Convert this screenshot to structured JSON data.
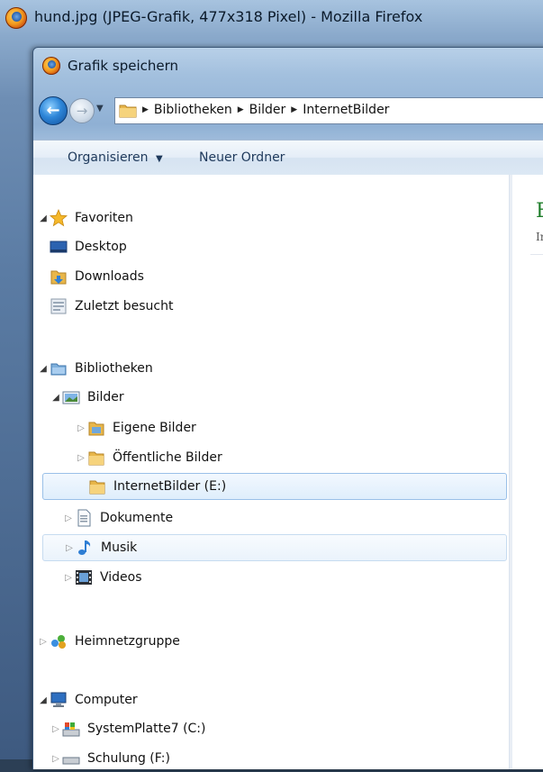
{
  "firefox": {
    "window_title": "hund.jpg (JPEG-Grafik, 477x318 Pixel) - Mozilla Firefox"
  },
  "dialog": {
    "title": "Grafik speichern",
    "breadcrumbs": [
      "Bibliotheken",
      "Bilder",
      "InternetBilder"
    ],
    "toolbar": {
      "organize": "Organisieren",
      "new_folder": "Neuer Ordner"
    },
    "nav_tree": {
      "favorites": {
        "label": "Favoriten",
        "items": [
          "Desktop",
          "Downloads",
          "Zuletzt besucht"
        ]
      },
      "libraries": {
        "label": "Bibliotheken",
        "pictures": {
          "label": "Bilder",
          "items": [
            "Eigene Bilder",
            "Öffentliche Bilder",
            "InternetBilder (E:)"
          ]
        },
        "items": [
          "Dokumente",
          "Musik",
          "Videos"
        ]
      },
      "homegroup": "Heimnetzgruppe",
      "computer": {
        "label": "Computer",
        "items": [
          "SystemPlatte7 (C:)",
          "Schulung (F:)"
        ]
      }
    },
    "right_pane": {
      "heading_fragment": "E",
      "sub_fragment": "Ir"
    }
  }
}
